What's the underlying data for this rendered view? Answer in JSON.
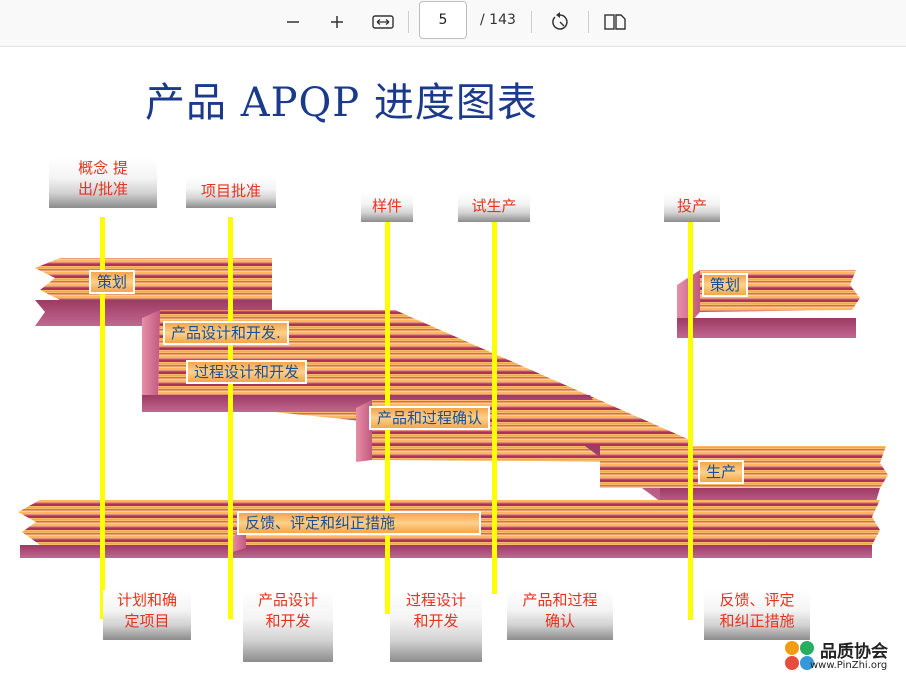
{
  "toolbar": {
    "zoom_out_icon": "minus-icon",
    "zoom_in_icon": "plus-icon",
    "fit_width_icon": "fit-width-icon",
    "page_current": "5",
    "page_total": "/ 143",
    "rotate_icon": "rotate-icon",
    "two_page_icon": "page-view-icon"
  },
  "diagram": {
    "title": "产品 APQP 进度图表",
    "milestones": [
      {
        "line1": "概念 提",
        "line2": "出/批准"
      },
      {
        "line1": "项目批准"
      },
      {
        "line1": "样件"
      },
      {
        "line1": "试生产"
      },
      {
        "line1": "投产"
      }
    ],
    "phases": {
      "planning": "策划",
      "product_design": "产品设计和开发.",
      "process_design": "过程设计和开发",
      "validation": "产品和过程确认",
      "planning_right": "策划",
      "production": "生产",
      "feedback": "反馈、评定和纠正措施"
    },
    "bottom_labels": [
      {
        "line1": "计划和确",
        "line2": "定项目"
      },
      {
        "line1": "产品设计",
        "line2": "和开发"
      },
      {
        "line1": "过程设计",
        "line2": "和开发"
      },
      {
        "line1": "产品和过程",
        "line2": "确认"
      },
      {
        "line1": "反馈、评定",
        "line2": "和纠正措施"
      }
    ],
    "colors": {
      "band_dark": "#b03060",
      "band_light": "#fdd08a",
      "milestone_line": "#ffff00",
      "label_text": "#e8321e",
      "title_text": "#1b3a8c"
    }
  },
  "logo": {
    "name": "品质协会",
    "url": "www.PinZhi.org"
  }
}
